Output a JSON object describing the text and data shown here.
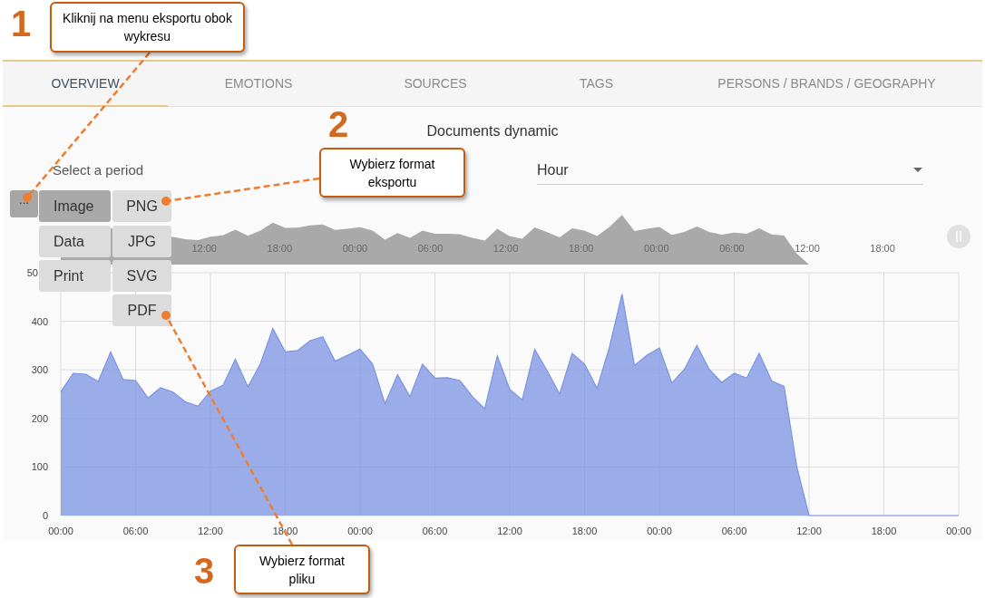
{
  "annotations": [
    {
      "number": "1",
      "text": "Kliknij na menu eksportu obok wykresu"
    },
    {
      "number": "2",
      "text": "Wybierz format eksportu"
    },
    {
      "number": "3",
      "text": "Wybierz format pliku"
    }
  ],
  "tabs": [
    {
      "label": "OVERVIEW",
      "selected": true
    },
    {
      "label": "EMOTIONS",
      "selected": false
    },
    {
      "label": "SOURCES",
      "selected": false
    },
    {
      "label": "TAGS",
      "selected": false
    },
    {
      "label": "PERSONS / BRANDS / GEOGRAPHY",
      "selected": false
    }
  ],
  "chart_title": "Documents dynamic",
  "period": {
    "label": "Select a period",
    "value": "Hour"
  },
  "export_menu": {
    "button": "...",
    "items": [
      {
        "label": "Image",
        "selected": true
      },
      {
        "label": "Data",
        "selected": false
      },
      {
        "label": "Print",
        "selected": false
      }
    ],
    "formats": [
      "PNG",
      "JPG",
      "SVG",
      "PDF"
    ]
  },
  "navigator": {
    "labels": [
      "12:00",
      "18:00",
      "00:00",
      "06:00",
      "12:00",
      "18:00",
      "00:00",
      "06:00",
      "12:00",
      "18:00"
    ]
  },
  "y_axis_cut_label": "50",
  "chart_data": {
    "type": "area",
    "grid": true,
    "ylim": [
      0,
      500
    ],
    "yticks": [
      0,
      100,
      200,
      300,
      400
    ],
    "categories": [
      "00:00",
      null,
      null,
      null,
      null,
      null,
      "06:00",
      null,
      null,
      null,
      null,
      null,
      "12:00",
      null,
      null,
      null,
      null,
      null,
      "18:00",
      null,
      null,
      null,
      null,
      null,
      "00:00",
      null,
      null,
      null,
      null,
      null,
      "06:00",
      null,
      null,
      null,
      null,
      null,
      "12:00",
      null,
      null,
      null,
      null,
      null,
      "18:00",
      null,
      null,
      null,
      null,
      null,
      "00:00",
      null,
      null,
      null,
      null,
      null,
      "06:00",
      null,
      null,
      null,
      null,
      null,
      "12:00",
      null,
      null,
      null,
      null,
      null,
      "18:00",
      null,
      null,
      null,
      null,
      null,
      "00:00"
    ],
    "series": [
      {
        "color": "#7b93e3",
        "values": [
          255,
          293,
          291,
          276,
          337,
          280,
          278,
          242,
          263,
          254,
          234,
          225,
          256,
          268,
          322,
          265,
          312,
          385,
          337,
          340,
          360,
          368,
          318,
          330,
          343,
          312,
          230,
          290,
          245,
          312,
          283,
          284,
          278,
          245,
          220,
          329,
          260,
          238,
          342,
          298,
          250,
          334,
          312,
          262,
          347,
          456,
          309,
          330,
          345,
          273,
          301,
          350,
          301,
          274,
          293,
          283,
          334,
          277,
          266,
          102,
          0,
          0,
          0,
          0,
          0,
          0,
          0,
          0,
          0,
          0,
          0,
          0,
          0
        ]
      }
    ]
  }
}
